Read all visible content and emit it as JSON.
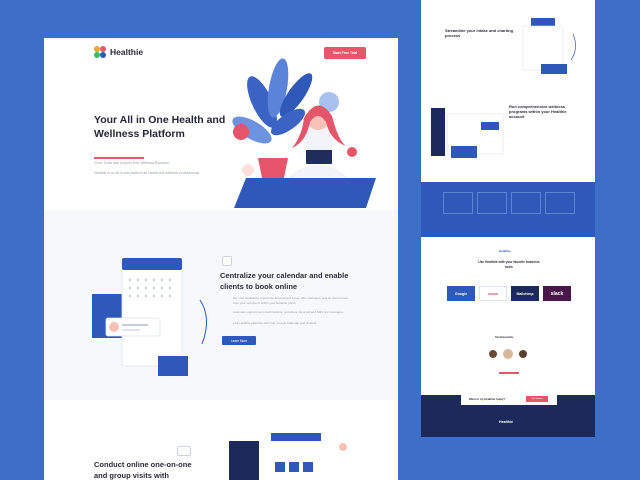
{
  "left": {
    "logo_text": "Healthie",
    "cta_label": "Start Free Trial",
    "hero_title": "Your All in One Health and Wellness Platform",
    "hero_sub": "Grow, Scale and Support Your Wellness Business",
    "hero_sub2": "Healthie is an all-in-one platform for health and wellness professionals",
    "section1_title": "Centralize your calendar and enable clients to book online",
    "section1_bullets": [
      "Set your availability, customize appointment types, offer packages, and let clients book from your website or within your Healthie portal",
      "Automatic appointment confirmations, reminders via email and SMS text messages",
      "Link Healthie calendar with iCal, Google Calendar and Outlook"
    ],
    "section1_button": "Learn More",
    "section2_title": "Conduct online one-on-one and group visits with"
  },
  "right": {
    "block1_title": "Streamline your intake and charting process",
    "block2_title": "Run comprehensive wellness programs within your Healthie account",
    "integrations_title": "Use Healthie with your favorite business tools",
    "brands": [
      "Google",
      "asana",
      "Mailchimp",
      "slack"
    ],
    "testimonials_title": "Testimonials",
    "trial_prompt": "Want to try Healthie today?",
    "trial_button": "Get Started",
    "footer_logo": "Healthie"
  },
  "colors": {
    "background": "#3d6fc9",
    "accent": "#e5566b",
    "primary": "#2e59b8",
    "navy": "#1b2a5a"
  }
}
